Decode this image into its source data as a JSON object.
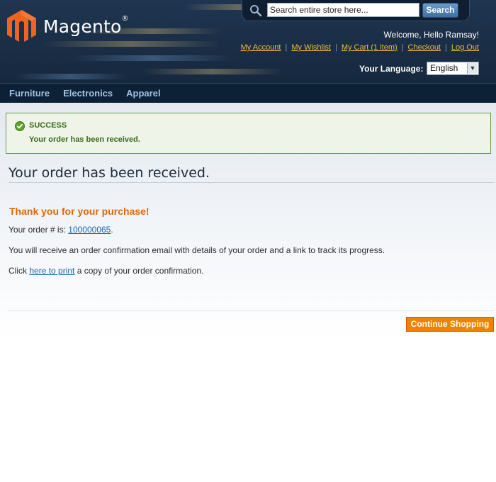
{
  "header": {
    "logo_text": "Magento",
    "logo_reg": "®",
    "search": {
      "placeholder": "Search entire store here...",
      "value": "Search entire store here...",
      "button_label": "Search"
    },
    "welcome": "Welcome, Hello Ramsay!",
    "links": [
      "My Account",
      "My Wishlist",
      "My Cart (1 item)",
      "Checkout",
      "Log Out"
    ],
    "language_label": "Your Language:",
    "language_value": "English"
  },
  "nav": {
    "items": [
      "Furniture",
      "Electronics",
      "Apparel"
    ]
  },
  "success": {
    "title": "SUCCESS",
    "message": "Your order has been received."
  },
  "main": {
    "page_title": "Your order has been received.",
    "thanks": "Thank you for your purchase!",
    "order_prefix": "Your order # is: ",
    "order_number": "100000065",
    "order_suffix": ".",
    "confirmation_text": "You will receive an order confirmation email with details of your order and a link to track its progress.",
    "print_prefix": "Click ",
    "print_link": "here to print",
    "print_suffix": " a copy of your order confirmation.",
    "continue_button": "Continue Shopping"
  },
  "colors": {
    "header_bg": "#1f3550",
    "nav_bg": "#0d2136",
    "link_gold": "#ebbb40",
    "success_green": "#3b6b17",
    "thanks_orange": "#e26703",
    "button_orange": "#f18200",
    "link_blue": "#1a67a8"
  },
  "icons": {
    "logo": "magento-logo-icon",
    "search": "magnifier-icon",
    "success": "check-circle-icon",
    "dropdown": "chevron-down-icon"
  }
}
